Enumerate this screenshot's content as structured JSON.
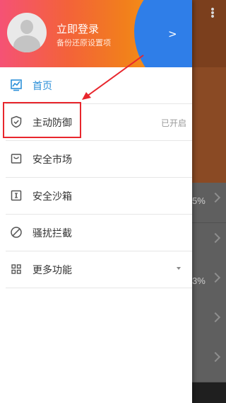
{
  "profile": {
    "login_title": "立即登录",
    "login_subtitle": "备份还原设置项"
  },
  "menu": {
    "items": [
      {
        "label": "首页",
        "icon": "home-chart-icon",
        "active": true
      },
      {
        "label": "主动防御",
        "icon": "shield-check-icon",
        "status": "已开启"
      },
      {
        "label": "安全市场",
        "icon": "market-bag-icon"
      },
      {
        "label": "安全沙箱",
        "icon": "sandbox-box-icon"
      },
      {
        "label": "骚扰拦截",
        "icon": "block-circle-icon"
      },
      {
        "label": "更多功能",
        "icon": "grid-icon",
        "has_dropdown": true
      }
    ]
  },
  "background": {
    "row_texts": [
      "5%",
      "",
      "3%",
      "",
      ""
    ]
  },
  "colors": {
    "accent_blue": "#2b8fd8",
    "annotation_red": "#e8262d"
  }
}
